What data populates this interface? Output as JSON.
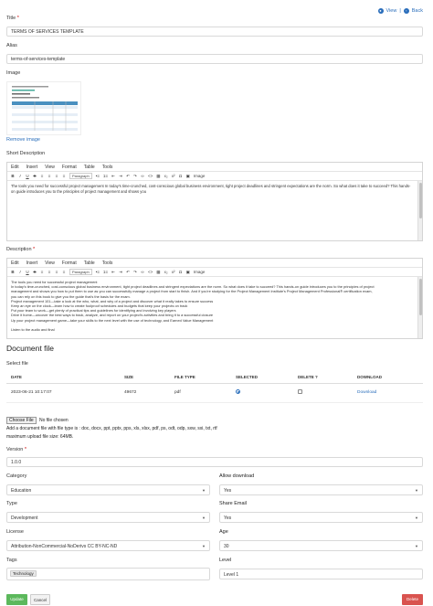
{
  "top_nav": {
    "view_label": "View",
    "separator": "|",
    "back_label": "Back"
  },
  "title": {
    "label": "Title",
    "required": "*",
    "value": "TERMS OF SERVICES TEMPLATE"
  },
  "alias": {
    "label": "Alias",
    "value": "terms-of-services-template"
  },
  "image": {
    "label": "Image",
    "remove_label": "Remove image"
  },
  "short_description": {
    "label": "Short Description",
    "menu": [
      "Edit",
      "Insert",
      "View",
      "Format",
      "Table",
      "Tools"
    ],
    "paragraph": "Paragraph",
    "image_btn": "Image",
    "content": "The tools you need for successful project management In today's time-crunched, cost-conscious global business environment, tight project deadlines and stringent expectations are the norm. So what does it take to succeed? This hands-on guide introduces you to the principles of project management and shows you"
  },
  "description": {
    "label": "Description",
    "required": "*",
    "menu": [
      "Edit",
      "Insert",
      "View",
      "Format",
      "Table",
      "Tools"
    ],
    "paragraph": "Paragraph",
    "image_btn": "Image",
    "lines": [
      "The tools you need for successful project management",
      "In today's time-crunched, cost-conscious global business environment, tight project deadlines and stringent expectations are the norm. So what does it take to succeed? This hands-on guide introduces you to the principles of project",
      "management and shows you how to put them to use as you can successfully manage a project from start to finish. And if you're studying for the Project Management Institute's Project Management Professional® certification exam,",
      "you can rely on this book to give you the guide that's the basis for the exam.",
      "Project management 101—take a look at the who, what, and why of a project and discover what it really takes to ensure success",
      "Keep an eye on the clock—learn how to create foolproof schedules and budgets that keep your projects on track",
      "Put your team to work—get plenty of practical tips and guidelines for identifying and involving key players",
      "Drive it home—uncover the best ways to track, analyze, and report on your project's activities and bring it to a successful closure",
      "Up your project management game—take your skills to the next level with the use of technology, and Earned Value Management",
      "",
      "Listen to the audio and final"
    ]
  },
  "document_file": {
    "heading": "Document file",
    "select_label": "Select file",
    "columns": [
      "DATE",
      "SIZE",
      "FILE TYPE",
      "SELECTED",
      "DELETE ?",
      "DOWNLOAD"
    ],
    "rows": [
      {
        "date": "2023-06-21 10:17:07",
        "size": "49672",
        "file_type": "pdf",
        "download": "Download"
      }
    ],
    "choose_btn": "Choose File",
    "no_file": "No file chosen",
    "help_types": "Add a document file with file type is : doc, docx, ppt, pptx, pps, xls, xlsx, pdf, ps, odt, odp, sxw, sxi, txt, rtf",
    "help_size": "maximum upload file size: 64MB."
  },
  "version": {
    "label": "Version",
    "required": "*",
    "value": "1.0.0"
  },
  "category": {
    "label": "Category",
    "value": "Education"
  },
  "allow_download": {
    "label": "Allow download",
    "value": "Yes"
  },
  "type": {
    "label": "Type",
    "value": "Development"
  },
  "share_email": {
    "label": "Share Email",
    "value": "Yes"
  },
  "license": {
    "label": "License",
    "value": "Attribution-NonCommercial-NoDerivs CC BY-NC-ND"
  },
  "age": {
    "label": "Age",
    "value": "30"
  },
  "tags": {
    "label": "Tags",
    "items": [
      "Technology"
    ]
  },
  "level": {
    "label": "Level",
    "value": "Level 1"
  },
  "actions": {
    "update": "Update",
    "cancel": "Cancel",
    "delete": "Delete"
  },
  "colors": {
    "update": "#5cb85c",
    "delete": "#d9534f",
    "link": "#2a6ebb"
  }
}
